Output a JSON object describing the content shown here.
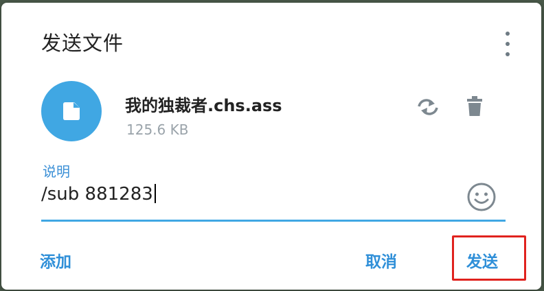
{
  "dialog": {
    "title": "发送文件",
    "menu_icon": "more-vertical-icon"
  },
  "file": {
    "icon": "document-icon",
    "name": "我的独裁者.chs.ass",
    "size": "125.6 KB",
    "replace_icon": "replace-icon",
    "delete_icon": "trash-icon"
  },
  "caption": {
    "label": "说明",
    "value": "/sub 881283",
    "emoji_icon": "emoji-icon"
  },
  "actions": {
    "add_label": "添加",
    "cancel_label": "取消",
    "send_label": "发送"
  },
  "colors": {
    "accent": "#40a7e3",
    "link": "#2f8fd8",
    "highlight": "#e0221e"
  }
}
